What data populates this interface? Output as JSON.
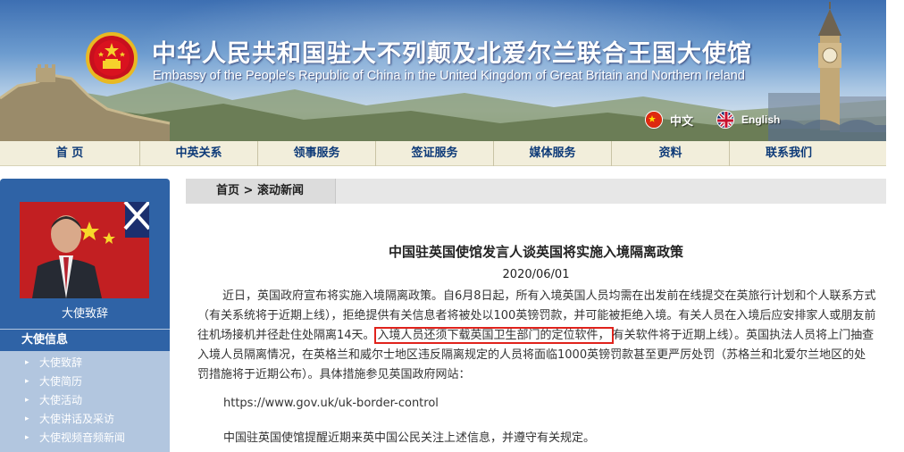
{
  "header": {
    "title_cn": "中华人民共和国驻大不列颠及北爱尔兰联合王国大使馆",
    "title_en": "Embassy of the People's Republic of China in the United Kingdom of Great Britain and Northern Ireland",
    "emblem_icon": "national-emblem-icon",
    "languages": [
      {
        "label": "中文",
        "icon": "china-flag-icon"
      },
      {
        "label": "English",
        "icon": "uk-flag-icon"
      }
    ]
  },
  "nav": {
    "items": [
      {
        "label": "首 页"
      },
      {
        "label": "中英关系"
      },
      {
        "label": "领事服务"
      },
      {
        "label": "签证服务"
      },
      {
        "label": "媒体服务"
      },
      {
        "label": "资料"
      },
      {
        "label": "联系我们"
      }
    ]
  },
  "sidebar": {
    "ambassador_caption": "大使致辞",
    "section_title": "大使信息",
    "items": [
      {
        "label": "大使致辞"
      },
      {
        "label": "大使简历"
      },
      {
        "label": "大使活动"
      },
      {
        "label": "大使讲话及采访"
      },
      {
        "label": "大使视频音频新闻"
      }
    ]
  },
  "breadcrumb": {
    "home": "首页",
    "separator": ">",
    "current": "滚动新闻"
  },
  "article": {
    "title": "中国驻英国使馆发言人谈英国将实施入境隔离政策",
    "date": "2020/06/01",
    "para1_before": "近日，英国政府宣布将实施入境隔离政策。自6月8日起，所有入境英国人员均需在出发前在线提交在英旅行计划和个人联系方式（有关系统将于近期上线），拒绝提供有关信息者将被处以100英镑罚款，并可能被拒绝入境。有关人员在入境后应安排家人或朋友前往机场接机并径赴住处隔离14天。",
    "para1_highlight": "入境人员还须下载英国卫生部门的定位软件，",
    "para1_after": "有关软件将于近期上线）。英国执法人员将上门抽查入境人员隔离情况，在英格兰和威尔士地区违反隔离规定的人员将面临1000英镑罚款甚至更严厉处罚（苏格兰和北爱尔兰地区的处罚措施将于近期公布）。具体措施参见英国政府网站：",
    "url": "https://www.gov.uk/uk-border-control",
    "closing": "中国驻英国使馆提醒近期来英中国公民关注上述信息，并遵守有关规定。"
  },
  "colors": {
    "nav_bg": "#f2eedb",
    "nav_text": "#0d3a78",
    "sidebar_dark": "#2f63a6",
    "sidebar_light": "#b2c6df",
    "highlight_border": "#e0231c"
  }
}
